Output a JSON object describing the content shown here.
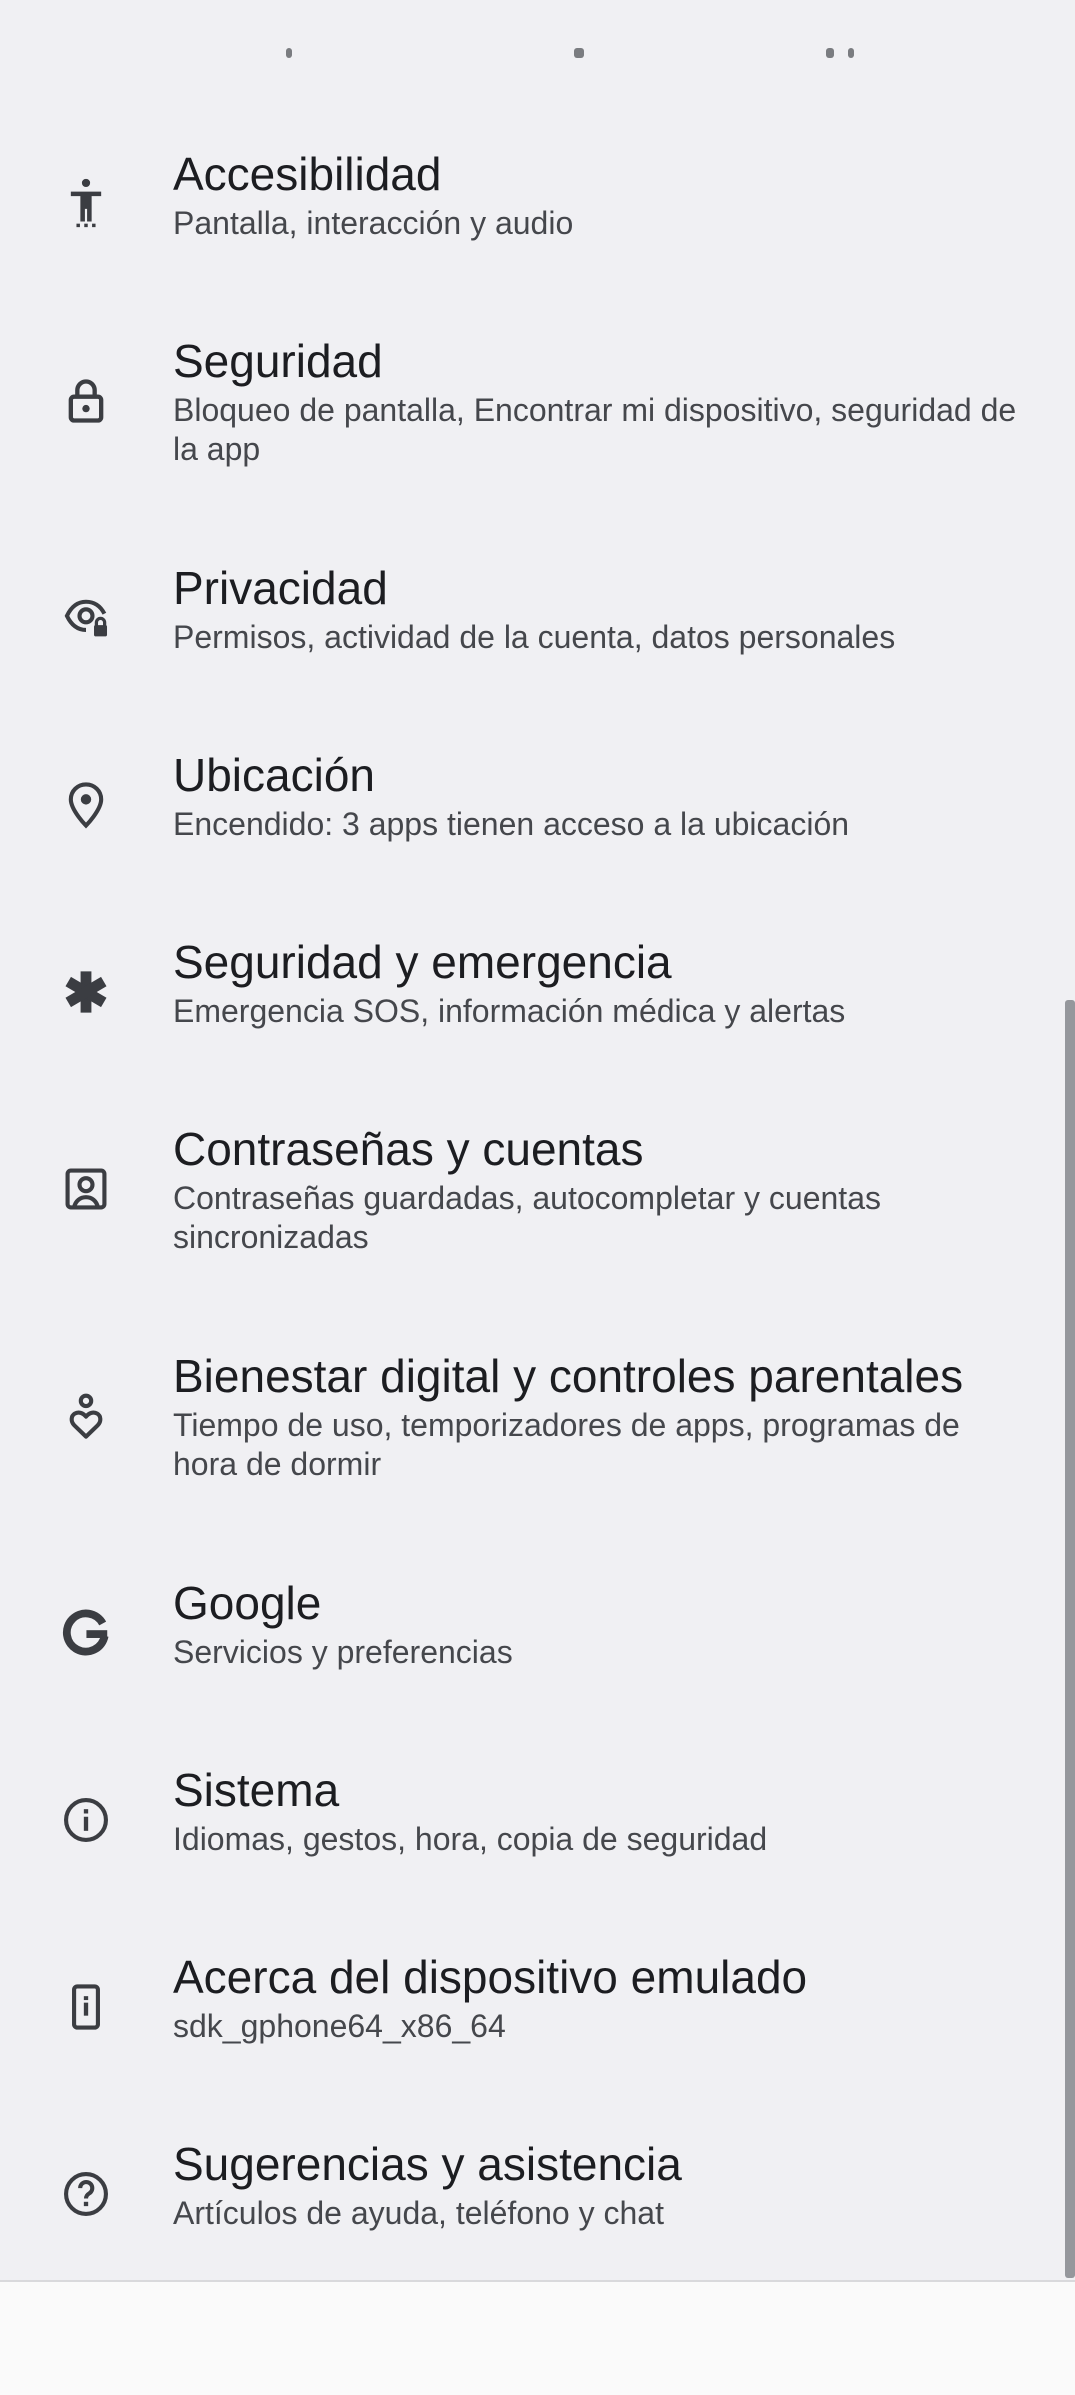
{
  "settings": {
    "items": [
      {
        "id": "accessibility",
        "icon": "accessibility-icon",
        "title": "Accesibilidad",
        "subtitle": "Pantalla, interacción y audio"
      },
      {
        "id": "security",
        "icon": "lock-icon",
        "title": "Seguridad",
        "subtitle": "Bloqueo de pantalla, Encontrar mi dispositivo, seguridad de la app"
      },
      {
        "id": "privacy",
        "icon": "privacy-eye-lock-icon",
        "title": "Privacidad",
        "subtitle": "Permisos, actividad de la cuenta, datos personales"
      },
      {
        "id": "location",
        "icon": "location-pin-icon",
        "title": "Ubicación",
        "subtitle": "Encendido: 3 apps tienen acceso a la ubicación"
      },
      {
        "id": "safety",
        "icon": "asterisk-emergency-icon",
        "title": "Seguridad y emergencia",
        "subtitle": "Emergencia SOS, información médica y alertas"
      },
      {
        "id": "passwords",
        "icon": "account-box-icon",
        "title": "Contraseñas y cuentas",
        "subtitle": "Contraseñas guardadas, autocompletar y cuentas sincronizadas"
      },
      {
        "id": "wellbeing",
        "icon": "wellbeing-heart-icon",
        "title": "Bienestar digital y controles parentales",
        "subtitle": "Tiempo de uso, temporizadores de apps, programas de hora de dormir"
      },
      {
        "id": "google",
        "icon": "google-g-icon",
        "title": "Google",
        "subtitle": "Servicios y preferencias"
      },
      {
        "id": "system",
        "icon": "info-icon",
        "title": "Sistema",
        "subtitle": "Idiomas, gestos, hora, copia de seguridad"
      },
      {
        "id": "about",
        "icon": "phone-info-icon",
        "title": "Acerca del dispositivo emulado",
        "subtitle": "sdk_gphone64_x86_64"
      },
      {
        "id": "help",
        "icon": "help-icon",
        "title": "Sugerencias y asistencia",
        "subtitle": "Artículos de ayuda, teléfono y chat"
      }
    ]
  },
  "colors": {
    "background": "#f0f0f3",
    "title": "#1c1d21",
    "subtitle": "#45474c",
    "icon": "#3b3d42",
    "scrollbar": "#95979c"
  }
}
